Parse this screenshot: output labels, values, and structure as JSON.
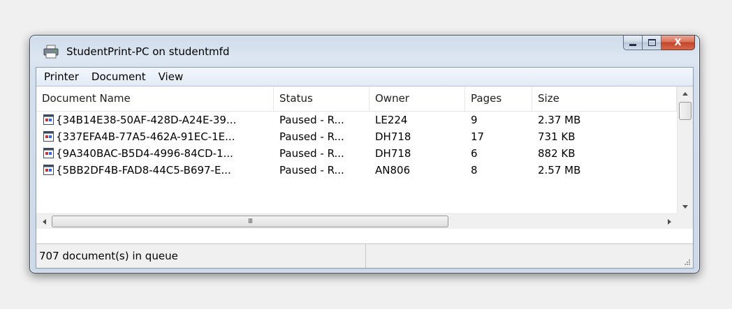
{
  "window": {
    "title": "StudentPrint-PC on studentmfd"
  },
  "caption": {
    "close_glyph": "X"
  },
  "menu": {
    "items": [
      {
        "label": "Printer"
      },
      {
        "label": "Document"
      },
      {
        "label": "View"
      }
    ]
  },
  "columns": [
    {
      "label": "Document Name"
    },
    {
      "label": "Status"
    },
    {
      "label": "Owner"
    },
    {
      "label": "Pages"
    },
    {
      "label": "Size"
    }
  ],
  "rows": [
    {
      "name": "{34B14E38-50AF-428D-A24E-39...",
      "status": "Paused - R...",
      "owner": "LE224",
      "pages": "9",
      "size": "2.37 MB"
    },
    {
      "name": "{337EFA4B-77A5-462A-91EC-1E...",
      "status": "Paused - R...",
      "owner": "DH718",
      "pages": "17",
      "size": "731 KB"
    },
    {
      "name": "{9A340BAC-B5D4-4996-84CD-1...",
      "status": "Paused - R...",
      "owner": "DH718",
      "pages": "6",
      "size": "882 KB"
    },
    {
      "name": "{5BB2DF4B-FAD8-44C5-B697-E...",
      "status": "Paused - R...",
      "owner": "AN806",
      "pages": "8",
      "size": "2.57 MB"
    }
  ],
  "scrollbar": {
    "grip_text": "III"
  },
  "status": {
    "queue_text": "707 document(s) in queue",
    "second_pane": ""
  },
  "icons": {
    "window": "printer-icon",
    "document": "document-icon"
  },
  "colors": {
    "window_frame": "#cfdcea",
    "close_button": "#c4452a",
    "client_background": "#ffffff"
  }
}
